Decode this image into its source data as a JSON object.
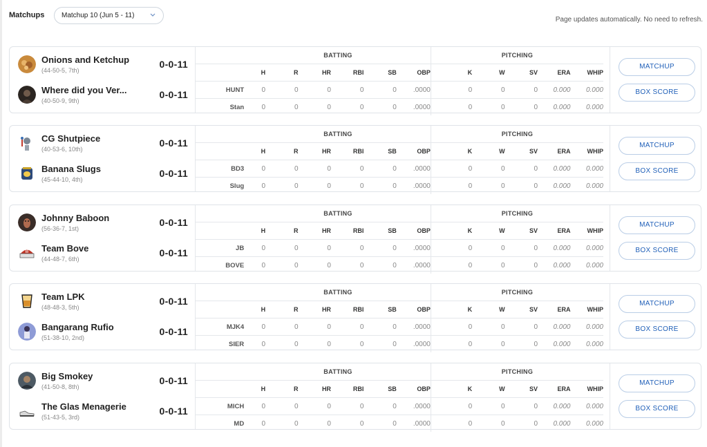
{
  "header": {
    "label": "Matchups",
    "selected_week": "Matchup 10 (Jun 5 - 11)",
    "notice": "Page updates automatically. No need to refresh."
  },
  "table_headers": {
    "batting": "BATTING",
    "pitching": "PITCHING",
    "batting_cols": [
      "H",
      "R",
      "HR",
      "RBI",
      "SB",
      "OBP"
    ],
    "pitching_cols": [
      "K",
      "W",
      "SV",
      "ERA",
      "WHIP"
    ]
  },
  "buttons": {
    "matchup": "MATCHUP",
    "box_score": "BOX SCORE"
  },
  "matchups": [
    {
      "teams": [
        {
          "name": "Onions and Ketchup",
          "record": "(44-50-5, 7th)",
          "score": "0-0-11",
          "abbr": "HUNT",
          "avatar": "onions-icon"
        },
        {
          "name": "Where did you Ver...",
          "record": "(40-50-9, 9th)",
          "score": "0-0-11",
          "abbr": "Stan",
          "avatar": "portrait-icon"
        }
      ],
      "rows": [
        [
          "0",
          "0",
          "0",
          "0",
          "0",
          ".0000",
          "0",
          "0",
          "0",
          "0.000",
          "0.000"
        ],
        [
          "0",
          "0",
          "0",
          "0",
          "0",
          ".0000",
          "0",
          "0",
          "0",
          "0.000",
          "0.000"
        ]
      ]
    },
    {
      "teams": [
        {
          "name": "CG Shutpiece",
          "record": "(40-53-6, 10th)",
          "score": "0-0-11",
          "abbr": "BD3",
          "avatar": "trophy-icon"
        },
        {
          "name": "Banana Slugs",
          "record": "(45-44-10, 4th)",
          "score": "0-0-11",
          "abbr": "Slug",
          "avatar": "slug-icon"
        }
      ],
      "rows": [
        [
          "0",
          "0",
          "0",
          "0",
          "0",
          ".0000",
          "0",
          "0",
          "0",
          "0.000",
          "0.000"
        ],
        [
          "0",
          "0",
          "0",
          "0",
          "0",
          ".0000",
          "0",
          "0",
          "0",
          "0.000",
          "0.000"
        ]
      ]
    },
    {
      "teams": [
        {
          "name": "Johnny Baboon",
          "record": "(56-36-7, 1st)",
          "score": "0-0-11",
          "abbr": "JB",
          "avatar": "baboon-icon"
        },
        {
          "name": "Team Bove",
          "record": "(44-48-7, 6th)",
          "score": "0-0-11",
          "abbr": "BOVE",
          "avatar": "cap-icon"
        }
      ],
      "rows": [
        [
          "0",
          "0",
          "0",
          "0",
          "0",
          ".0000",
          "0",
          "0",
          "0",
          "0.000",
          "0.000"
        ],
        [
          "0",
          "0",
          "0",
          "0",
          "0",
          ".0000",
          "0",
          "0",
          "0",
          "0.000",
          "0.000"
        ]
      ]
    },
    {
      "teams": [
        {
          "name": "Team LPK",
          "record": "(48-48-3, 5th)",
          "score": "0-0-11",
          "abbr": "MJK4",
          "avatar": "drink-icon"
        },
        {
          "name": "Bangarang Rufio",
          "record": "(51-38-10, 2nd)",
          "score": "0-0-11",
          "abbr": "SIER",
          "avatar": "player-icon"
        }
      ],
      "rows": [
        [
          "0",
          "0",
          "0",
          "0",
          "0",
          ".0000",
          "0",
          "0",
          "0",
          "0.000",
          "0.000"
        ],
        [
          "0",
          "0",
          "0",
          "0",
          "0",
          ".0000",
          "0",
          "0",
          "0",
          "0.000",
          "0.000"
        ]
      ]
    },
    {
      "teams": [
        {
          "name": "Big Smokey",
          "record": "(41-50-8, 8th)",
          "score": "0-0-11",
          "abbr": "MICH",
          "avatar": "smokey-icon"
        },
        {
          "name": "The Glas Menagerie",
          "record": "(51-43-5, 3rd)",
          "score": "0-0-11",
          "abbr": "MD",
          "avatar": "shoe-icon"
        }
      ],
      "rows": [
        [
          "0",
          "0",
          "0",
          "0",
          "0",
          ".0000",
          "0",
          "0",
          "0",
          "0.000",
          "0.000"
        ],
        [
          "0",
          "0",
          "0",
          "0",
          "0",
          ".0000",
          "0",
          "0",
          "0",
          "0.000",
          "0.000"
        ]
      ]
    }
  ]
}
